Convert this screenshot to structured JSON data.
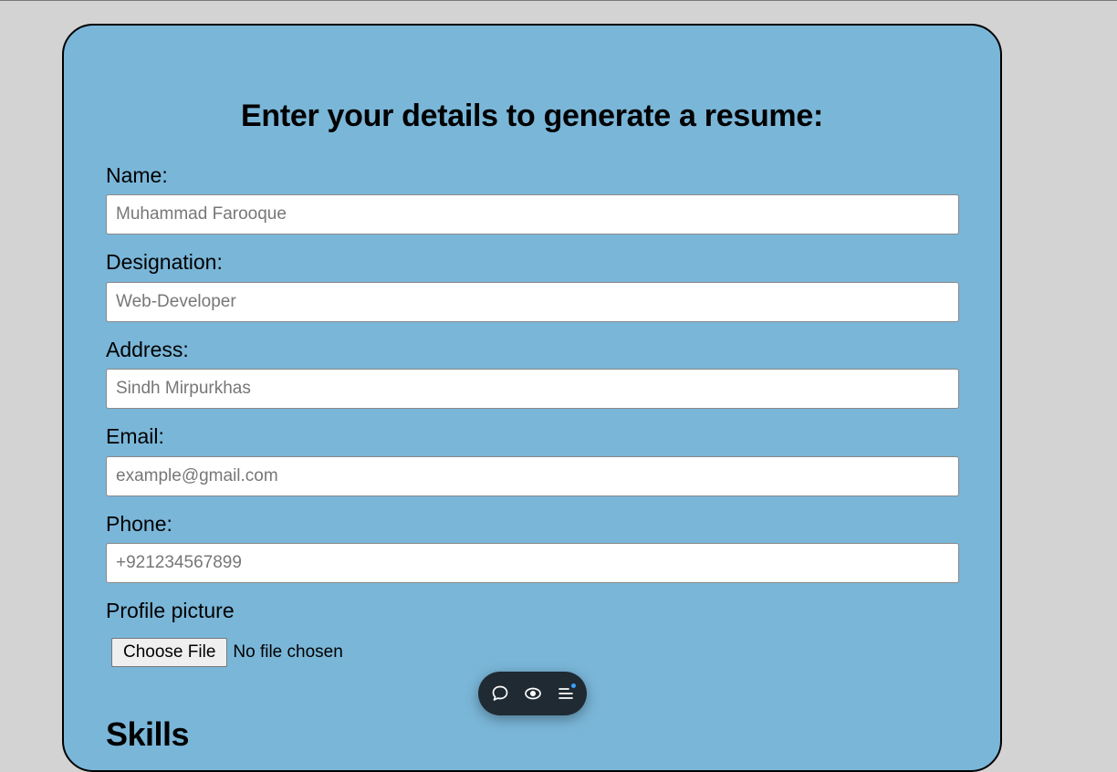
{
  "form": {
    "heading": "Enter your details to generate a resume:",
    "fields": [
      {
        "label": "Name:",
        "placeholder": "Muhammad Farooque",
        "value": ""
      },
      {
        "label": "Designation:",
        "placeholder": "Web-Developer",
        "value": ""
      },
      {
        "label": "Address:",
        "placeholder": "Sindh Mirpurkhas",
        "value": ""
      },
      {
        "label": "Email:",
        "placeholder": "example@gmail.com",
        "value": ""
      },
      {
        "label": "Phone:",
        "placeholder": "+921234567899",
        "value": ""
      }
    ],
    "profile_picture": {
      "label": "Profile picture",
      "button_label": "Choose File",
      "status": "No file chosen"
    },
    "skills_heading": "Skills"
  },
  "toolbar": {
    "icons": [
      "comment-icon",
      "eye-icon",
      "menu-icon"
    ],
    "notification_color": "#3aa0ff"
  },
  "colors": {
    "page_background": "#d3d3d3",
    "card_background": "#7ab6d8",
    "toolbar_background": "#1f2a33"
  }
}
